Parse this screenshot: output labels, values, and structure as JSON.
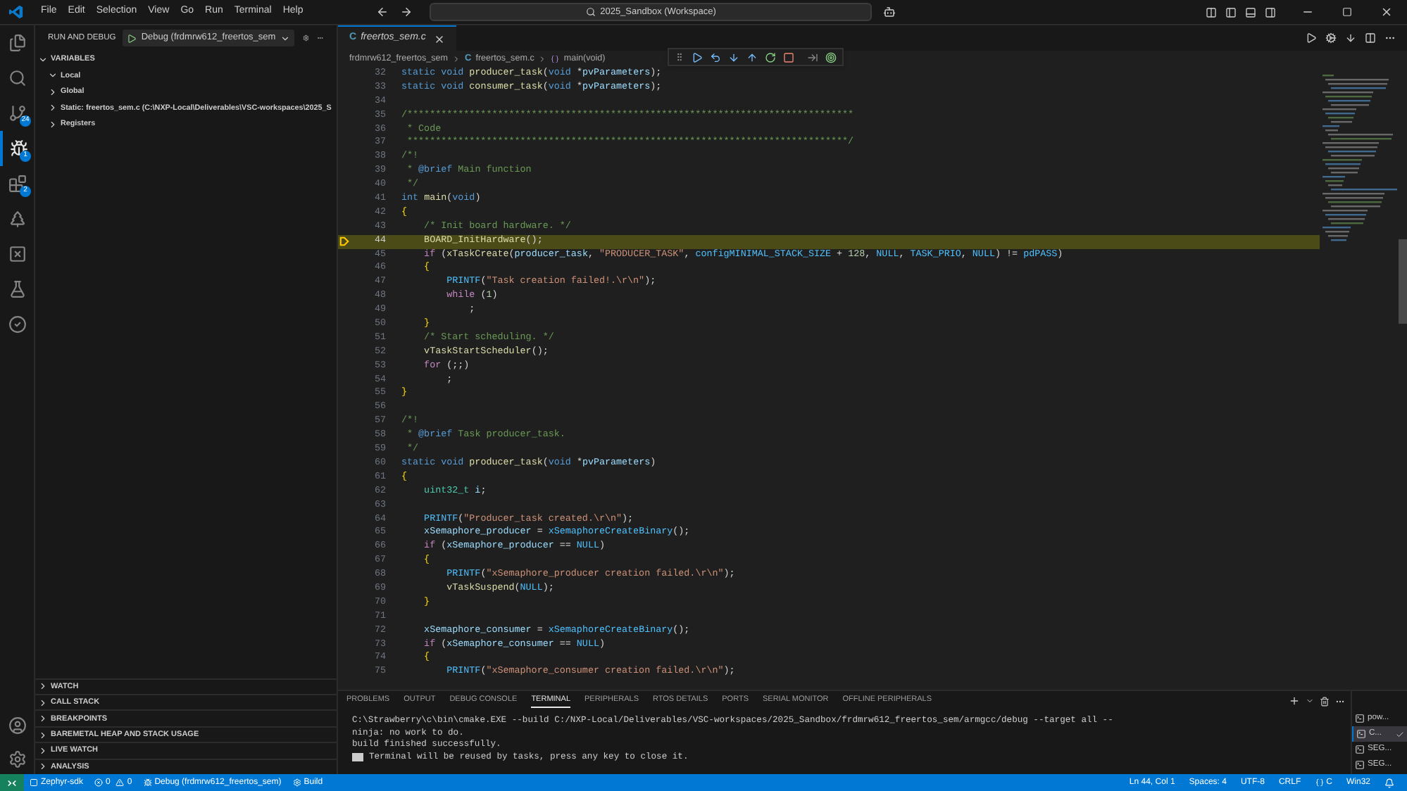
{
  "title_bar": {
    "menu": [
      "File",
      "Edit",
      "Selection",
      "View",
      "Go",
      "Run",
      "Terminal",
      "Help"
    ],
    "search": "2025_Sandbox (Workspace)"
  },
  "activity_bar": {
    "items": [
      {
        "selected": false
      },
      {
        "selected": false
      },
      {
        "selected": false,
        "badge": "24"
      },
      {
        "selected": true,
        "badge": "1"
      },
      {
        "selected": false,
        "badge": "2"
      },
      {
        "selected": false
      },
      {
        "selected": false
      },
      {
        "selected": false
      },
      {
        "selected": false
      }
    ]
  },
  "sidebar": {
    "title": "RUN AND DEBUG",
    "config": "Debug (frdmrw612_freertos_sem",
    "variables": {
      "title": "VARIABLES",
      "expanded": true,
      "items": [
        {
          "label": "Local",
          "expanded": true
        },
        {
          "label": "Global",
          "expanded": false
        },
        {
          "label": "Static: freertos_sem.c (C:\\NXP-Local\\Deliverables\\VSC-workspaces\\2025_S",
          "expanded": false
        },
        {
          "label": "Registers",
          "expanded": false
        }
      ]
    },
    "sections": [
      {
        "label": "WATCH",
        "expanded": false
      },
      {
        "label": "CALL STACK",
        "expanded": false
      },
      {
        "label": "BREAKPOINTS",
        "expanded": false
      },
      {
        "label": "BAREMETAL HEAP AND STACK USAGE",
        "expanded": false
      },
      {
        "label": "LIVE WATCH",
        "expanded": false
      },
      {
        "label": "ANALYSIS",
        "expanded": false
      }
    ]
  },
  "editor": {
    "tabs": [
      {
        "label": "freertos_sem.c",
        "badge": "C",
        "selected": true
      }
    ],
    "breadcrumbs": [
      {
        "kind": "folder",
        "text": "frdmrw612_freertos_sem"
      },
      {
        "kind": "file",
        "text": "freertos_sem.c",
        "badge": "C"
      },
      {
        "kind": "symbol",
        "text": "main(void)"
      }
    ],
    "lines": [
      {
        "n": "32",
        "current": false,
        "seg": [
          {
            "kind": "kw",
            "text": "static void "
          },
          {
            "kind": "fn",
            "text": "producer_task"
          },
          {
            "kind": "pl",
            "text": "("
          },
          {
            "kind": "kw",
            "text": "void "
          },
          {
            "kind": "pl",
            "text": "*"
          },
          {
            "kind": "var",
            "text": "pvParameters"
          },
          {
            "kind": "pl",
            "text": ");"
          }
        ]
      },
      {
        "n": "33",
        "current": false,
        "seg": [
          {
            "kind": "kw",
            "text": "static void "
          },
          {
            "kind": "fn",
            "text": "consumer_task"
          },
          {
            "kind": "pl",
            "text": "("
          },
          {
            "kind": "kw",
            "text": "void "
          },
          {
            "kind": "pl",
            "text": "*"
          },
          {
            "kind": "var",
            "text": "pvParameters"
          },
          {
            "kind": "pl",
            "text": ");"
          }
        ]
      },
      {
        "n": "34",
        "current": false
      },
      {
        "n": "35",
        "current": false,
        "seg": [
          {
            "kind": "cm",
            "text": "/*******************************************************************************"
          }
        ]
      },
      {
        "n": "36",
        "current": false,
        "seg": [
          {
            "kind": "cm",
            "text": " * Code"
          }
        ]
      },
      {
        "n": "37",
        "current": false,
        "seg": [
          {
            "kind": "cm",
            "text": " ******************************************************************************/"
          }
        ]
      },
      {
        "n": "38",
        "current": false,
        "seg": [
          {
            "kind": "cm",
            "text": "/*!"
          }
        ]
      },
      {
        "n": "39",
        "current": false,
        "seg": [
          {
            "kind": "cm",
            "text": " * "
          },
          {
            "kind": "kw",
            "text": "@brief"
          },
          {
            "kind": "cm",
            "text": " Main function"
          }
        ]
      },
      {
        "n": "40",
        "current": false,
        "seg": [
          {
            "kind": "cm",
            "text": " */"
          }
        ]
      },
      {
        "n": "41",
        "current": false,
        "seg": [
          {
            "kind": "kw",
            "text": "int "
          },
          {
            "kind": "fn",
            "text": "main"
          },
          {
            "kind": "pl",
            "text": "("
          },
          {
            "kind": "kw",
            "text": "void"
          },
          {
            "kind": "pl",
            "text": ")"
          }
        ]
      },
      {
        "n": "42",
        "current": false,
        "seg": [
          {
            "kind": "br",
            "text": "{"
          }
        ]
      },
      {
        "n": "43",
        "current": false,
        "seg": [
          {
            "kind": "cm",
            "text": "    /* Init board hardware. */"
          }
        ]
      },
      {
        "n": "44",
        "current": true,
        "seg": [
          {
            "kind": "fn",
            "text": "    BOARD_InitHardware"
          },
          {
            "kind": "pl",
            "text": "();"
          }
        ]
      },
      {
        "n": "45",
        "current": false,
        "seg": [
          {
            "kind": "ctl",
            "text": "    if "
          },
          {
            "kind": "pl",
            "text": "("
          },
          {
            "kind": "fn",
            "text": "xTaskCreate"
          },
          {
            "kind": "pl",
            "text": "("
          },
          {
            "kind": "var",
            "text": "producer_task"
          },
          {
            "kind": "pl",
            "text": ", "
          },
          {
            "kind": "str",
            "text": "\"PRODUCER_TASK\""
          },
          {
            "kind": "pl",
            "text": ", "
          },
          {
            "kind": "mac",
            "text": "configMINIMAL_STACK_SIZE"
          },
          {
            "kind": "pl",
            "text": " + "
          },
          {
            "kind": "num",
            "text": "128"
          },
          {
            "kind": "pl",
            "text": ", "
          },
          {
            "kind": "mac",
            "text": "NULL"
          },
          {
            "kind": "pl",
            "text": ", "
          },
          {
            "kind": "mac",
            "text": "TASK_PRIO"
          },
          {
            "kind": "pl",
            "text": ", "
          },
          {
            "kind": "mac",
            "text": "NULL"
          },
          {
            "kind": "pl",
            "text": ") != "
          },
          {
            "kind": "mac",
            "text": "pdPASS"
          },
          {
            "kind": "pl",
            "text": ")"
          }
        ]
      },
      {
        "n": "46",
        "current": false,
        "seg": [
          {
            "kind": "br",
            "text": "    {"
          }
        ]
      },
      {
        "n": "47",
        "current": false,
        "seg": [
          {
            "kind": "mac",
            "text": "        PRINTF"
          },
          {
            "kind": "pl",
            "text": "("
          },
          {
            "kind": "str",
            "text": "\"Task creation failed!.\\r\\n\""
          },
          {
            "kind": "pl",
            "text": ");"
          }
        ]
      },
      {
        "n": "48",
        "current": false,
        "seg": [
          {
            "kind": "ctl",
            "text": "        while "
          },
          {
            "kind": "pl",
            "text": "("
          },
          {
            "kind": "num",
            "text": "1"
          },
          {
            "kind": "pl",
            "text": ")"
          }
        ]
      },
      {
        "n": "49",
        "current": false,
        "seg": [
          {
            "kind": "pl",
            "text": "            ;"
          }
        ]
      },
      {
        "n": "50",
        "current": false,
        "seg": [
          {
            "kind": "br",
            "text": "    }"
          }
        ]
      },
      {
        "n": "51",
        "current": false,
        "seg": [
          {
            "kind": "cm",
            "text": "    /* Start scheduling. */"
          }
        ]
      },
      {
        "n": "52",
        "current": false,
        "seg": [
          {
            "kind": "fn",
            "text": "    vTaskStartScheduler"
          },
          {
            "kind": "pl",
            "text": "();"
          }
        ]
      },
      {
        "n": "53",
        "current": false,
        "seg": [
          {
            "kind": "ctl",
            "text": "    for "
          },
          {
            "kind": "pl",
            "text": "(;;)"
          }
        ]
      },
      {
        "n": "54",
        "current": false,
        "seg": [
          {
            "kind": "pl",
            "text": "        ;"
          }
        ]
      },
      {
        "n": "55",
        "current": false,
        "seg": [
          {
            "kind": "br",
            "text": "}"
          }
        ]
      },
      {
        "n": "56",
        "current": false
      },
      {
        "n": "57",
        "current": false,
        "seg": [
          {
            "kind": "cm",
            "text": "/*!"
          }
        ]
      },
      {
        "n": "58",
        "current": false,
        "seg": [
          {
            "kind": "cm",
            "text": " * "
          },
          {
            "kind": "kw",
            "text": "@brief"
          },
          {
            "kind": "cm",
            "text": " Task producer_task."
          }
        ]
      },
      {
        "n": "59",
        "current": false,
        "seg": [
          {
            "kind": "cm",
            "text": " */"
          }
        ]
      },
      {
        "n": "60",
        "current": false,
        "seg": [
          {
            "kind": "kw",
            "text": "static void "
          },
          {
            "kind": "fn",
            "text": "producer_task"
          },
          {
            "kind": "pl",
            "text": "("
          },
          {
            "kind": "kw",
            "text": "void "
          },
          {
            "kind": "pl",
            "text": "*"
          },
          {
            "kind": "var",
            "text": "pvParameters"
          },
          {
            "kind": "pl",
            "text": ")"
          }
        ]
      },
      {
        "n": "61",
        "current": false,
        "seg": [
          {
            "kind": "br",
            "text": "{"
          }
        ]
      },
      {
        "n": "62",
        "current": false,
        "seg": [
          {
            "kind": "type",
            "text": "    uint32_t "
          },
          {
            "kind": "var",
            "text": "i"
          },
          {
            "kind": "pl",
            "text": ";"
          }
        ]
      },
      {
        "n": "63",
        "current": false
      },
      {
        "n": "64",
        "current": false,
        "seg": [
          {
            "kind": "mac",
            "text": "    PRINTF"
          },
          {
            "kind": "pl",
            "text": "("
          },
          {
            "kind": "str",
            "text": "\"Producer_task created.\\r\\n\""
          },
          {
            "kind": "pl",
            "text": ");"
          }
        ]
      },
      {
        "n": "65",
        "current": false,
        "seg": [
          {
            "kind": "var",
            "text": "    xSemaphore_producer"
          },
          {
            "kind": "pl",
            "text": " = "
          },
          {
            "kind": "mac",
            "text": "xSemaphoreCreateBinary"
          },
          {
            "kind": "pl",
            "text": "();"
          }
        ]
      },
      {
        "n": "66",
        "current": false,
        "seg": [
          {
            "kind": "ctl",
            "text": "    if "
          },
          {
            "kind": "pl",
            "text": "("
          },
          {
            "kind": "var",
            "text": "xSemaphore_producer"
          },
          {
            "kind": "pl",
            "text": " == "
          },
          {
            "kind": "mac",
            "text": "NULL"
          },
          {
            "kind": "pl",
            "text": ")"
          }
        ]
      },
      {
        "n": "67",
        "current": false,
        "seg": [
          {
            "kind": "br",
            "text": "    {"
          }
        ]
      },
      {
        "n": "68",
        "current": false,
        "seg": [
          {
            "kind": "mac",
            "text": "        PRINTF"
          },
          {
            "kind": "pl",
            "text": "("
          },
          {
            "kind": "str",
            "text": "\"xSemaphore_producer creation failed.\\r\\n\""
          },
          {
            "kind": "pl",
            "text": ");"
          }
        ]
      },
      {
        "n": "69",
        "current": false,
        "seg": [
          {
            "kind": "fn",
            "text": "        vTaskSuspend"
          },
          {
            "kind": "pl",
            "text": "("
          },
          {
            "kind": "mac",
            "text": "NULL"
          },
          {
            "kind": "pl",
            "text": ");"
          }
        ]
      },
      {
        "n": "70",
        "current": false,
        "seg": [
          {
            "kind": "br",
            "text": "    }"
          }
        ]
      },
      {
        "n": "71",
        "current": false
      },
      {
        "n": "72",
        "current": false,
        "seg": [
          {
            "kind": "var",
            "text": "    xSemaphore_consumer"
          },
          {
            "kind": "pl",
            "text": " = "
          },
          {
            "kind": "mac",
            "text": "xSemaphoreCreateBinary"
          },
          {
            "kind": "pl",
            "text": "();"
          }
        ]
      },
      {
        "n": "73",
        "current": false,
        "seg": [
          {
            "kind": "ctl",
            "text": "    if "
          },
          {
            "kind": "pl",
            "text": "("
          },
          {
            "kind": "var",
            "text": "xSemaphore_consumer"
          },
          {
            "kind": "pl",
            "text": " == "
          },
          {
            "kind": "mac",
            "text": "NULL"
          },
          {
            "kind": "pl",
            "text": ")"
          }
        ]
      },
      {
        "n": "74",
        "current": false,
        "seg": [
          {
            "kind": "br",
            "text": "    {"
          }
        ]
      },
      {
        "n": "75",
        "current": false,
        "seg": [
          {
            "kind": "mac",
            "text": "        PRINTF"
          },
          {
            "kind": "pl",
            "text": "("
          },
          {
            "kind": "str",
            "text": "\"xSemaphore_consumer creation failed.\\r\\n\""
          },
          {
            "kind": "pl",
            "text": ");"
          }
        ]
      }
    ]
  },
  "panel": {
    "tabs": [
      {
        "label": "PROBLEMS",
        "selected": false
      },
      {
        "label": "OUTPUT",
        "selected": false
      },
      {
        "label": "DEBUG CONSOLE",
        "selected": false
      },
      {
        "label": "TERMINAL",
        "selected": true
      },
      {
        "label": "PERIPHERALS",
        "selected": false
      },
      {
        "label": "RTOS DETAILS",
        "selected": false
      },
      {
        "label": "PORTS",
        "selected": false
      },
      {
        "label": "SERIAL MONITOR",
        "selected": false
      },
      {
        "label": "OFFLINE PERIPHERALS",
        "selected": false
      }
    ],
    "terminal": [
      {
        "kind": "output",
        "text": "C:\\Strawberry\\c\\bin\\cmake.EXE --build C:/NXP-Local/Deliverables/VSC-workspaces/2025_Sandbox/frdmrw612_freertos_sem/armgcc/debug --target all --"
      },
      {
        "kind": "output",
        "text": "ninja: no work to do."
      },
      {
        "kind": "output",
        "text": "build finished successfully."
      },
      {
        "kind": "notice",
        "text": "Terminal will be reused by tasks, press any key to close it."
      }
    ],
    "terminal_list": [
      {
        "label": "pow...",
        "selected": false
      },
      {
        "label": "C...",
        "selected": true
      },
      {
        "label": "SEG...",
        "selected": false
      },
      {
        "label": "SEG...",
        "selected": false
      }
    ]
  },
  "status_bar": {
    "left": [
      {
        "kind": "remote"
      },
      {
        "kind": "sdk",
        "text": "Zephyr-sdk"
      },
      {
        "kind": "problems",
        "errors": "0",
        "warnings": "0"
      },
      {
        "kind": "debug",
        "text": "Debug (frdmrw612_freertos_sem)"
      },
      {
        "kind": "build",
        "text": "Build"
      }
    ],
    "right": [
      {
        "kind": "text",
        "text": "Ln 44, Col 1"
      },
      {
        "kind": "text",
        "text": "Spaces: 4"
      },
      {
        "kind": "text",
        "text": "UTF-8"
      },
      {
        "kind": "text",
        "text": "CRLF"
      },
      {
        "kind": "lang",
        "text": "C"
      },
      {
        "kind": "text",
        "text": "Win32"
      },
      {
        "kind": "bell"
      }
    ]
  }
}
